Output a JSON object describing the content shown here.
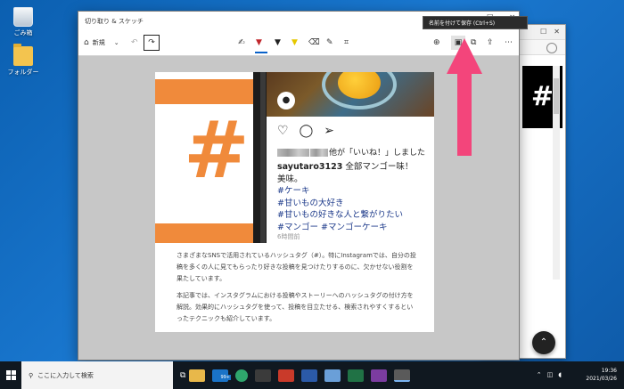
{
  "desktop": {
    "icons": [
      {
        "label": "ごみ箱"
      },
      {
        "label": "フォルダー"
      }
    ]
  },
  "app": {
    "title": "切り取り & スケッチ",
    "tooltip": "名前を付けて保存 (Ctrl+S)",
    "new_label": "新規"
  },
  "document": {
    "likes_suffix": "他が「いいね！」しました",
    "caption_user": "sayutaro3123",
    "caption_text": "全部マンゴー味！",
    "caption_line2": "美味。",
    "tags": [
      "#ケーキ",
      "#甘いもの大好き",
      "#甘いもの好きな人と繋がりたい",
      "#マンゴー #マンゴーケーキ"
    ],
    "time_ago": "6時間前",
    "paragraph1": "さまざまなSNSで活用されているハッシュタグ（#）。特にInstagramでは、自分の投稿を多くの人に見てもらったり好きな投稿を見つけたりするのに、欠かせない役割を果たしています。",
    "paragraph2": "本記事では、インスタグラムにおける投稿やストーリーへのハッシュタグの付け方を解説。効果的にハッシュタグを使って、投稿を目立たせる、検索されやすくするといったテクニックも紹介しています。"
  },
  "taskbar": {
    "search_placeholder": "ここに入力して検索",
    "time": "19:36",
    "date": "2021/03/26",
    "badge": "99+"
  }
}
